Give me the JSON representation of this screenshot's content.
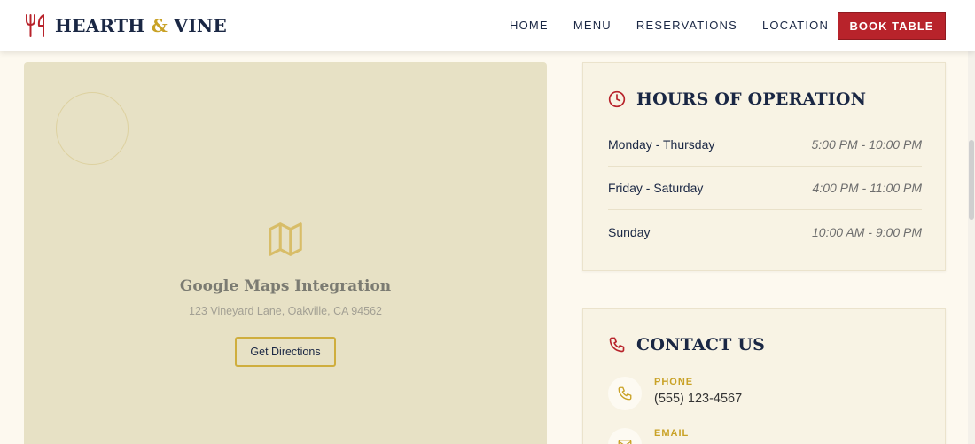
{
  "brand": {
    "name_part1": "HEARTH",
    "ampersand": "&",
    "name_part2": "VINE",
    "icon": "fork-knife-icon"
  },
  "nav": {
    "items": [
      "HOME",
      "MENU",
      "RESERVATIONS",
      "LOCATION"
    ],
    "cta": "BOOK TABLE"
  },
  "map": {
    "icon": "map-icon",
    "title": "Google Maps Integration",
    "address": "123 Vineyard Lane, Oakville, CA 94562",
    "button": "Get Directions"
  },
  "hours": {
    "icon": "clock-icon",
    "title": "HOURS OF OPERATION",
    "rows": [
      {
        "day": "Monday - Thursday",
        "time": "5:00 PM - 10:00 PM"
      },
      {
        "day": "Friday - Saturday",
        "time": "4:00 PM - 11:00 PM"
      },
      {
        "day": "Sunday",
        "time": "10:00 AM - 9:00 PM"
      }
    ]
  },
  "contact": {
    "icon": "phone-icon",
    "title": "CONTACT US",
    "items": [
      {
        "label": "PHONE",
        "value": "(555) 123-4567",
        "icon": "phone-icon"
      },
      {
        "label": "EMAIL",
        "value": "",
        "icon": "mail-icon"
      }
    ]
  },
  "colors": {
    "accent": "#b8232b",
    "gold": "#c9a227",
    "navy": "#1a2744",
    "map_bg": "#e7e1c5"
  }
}
